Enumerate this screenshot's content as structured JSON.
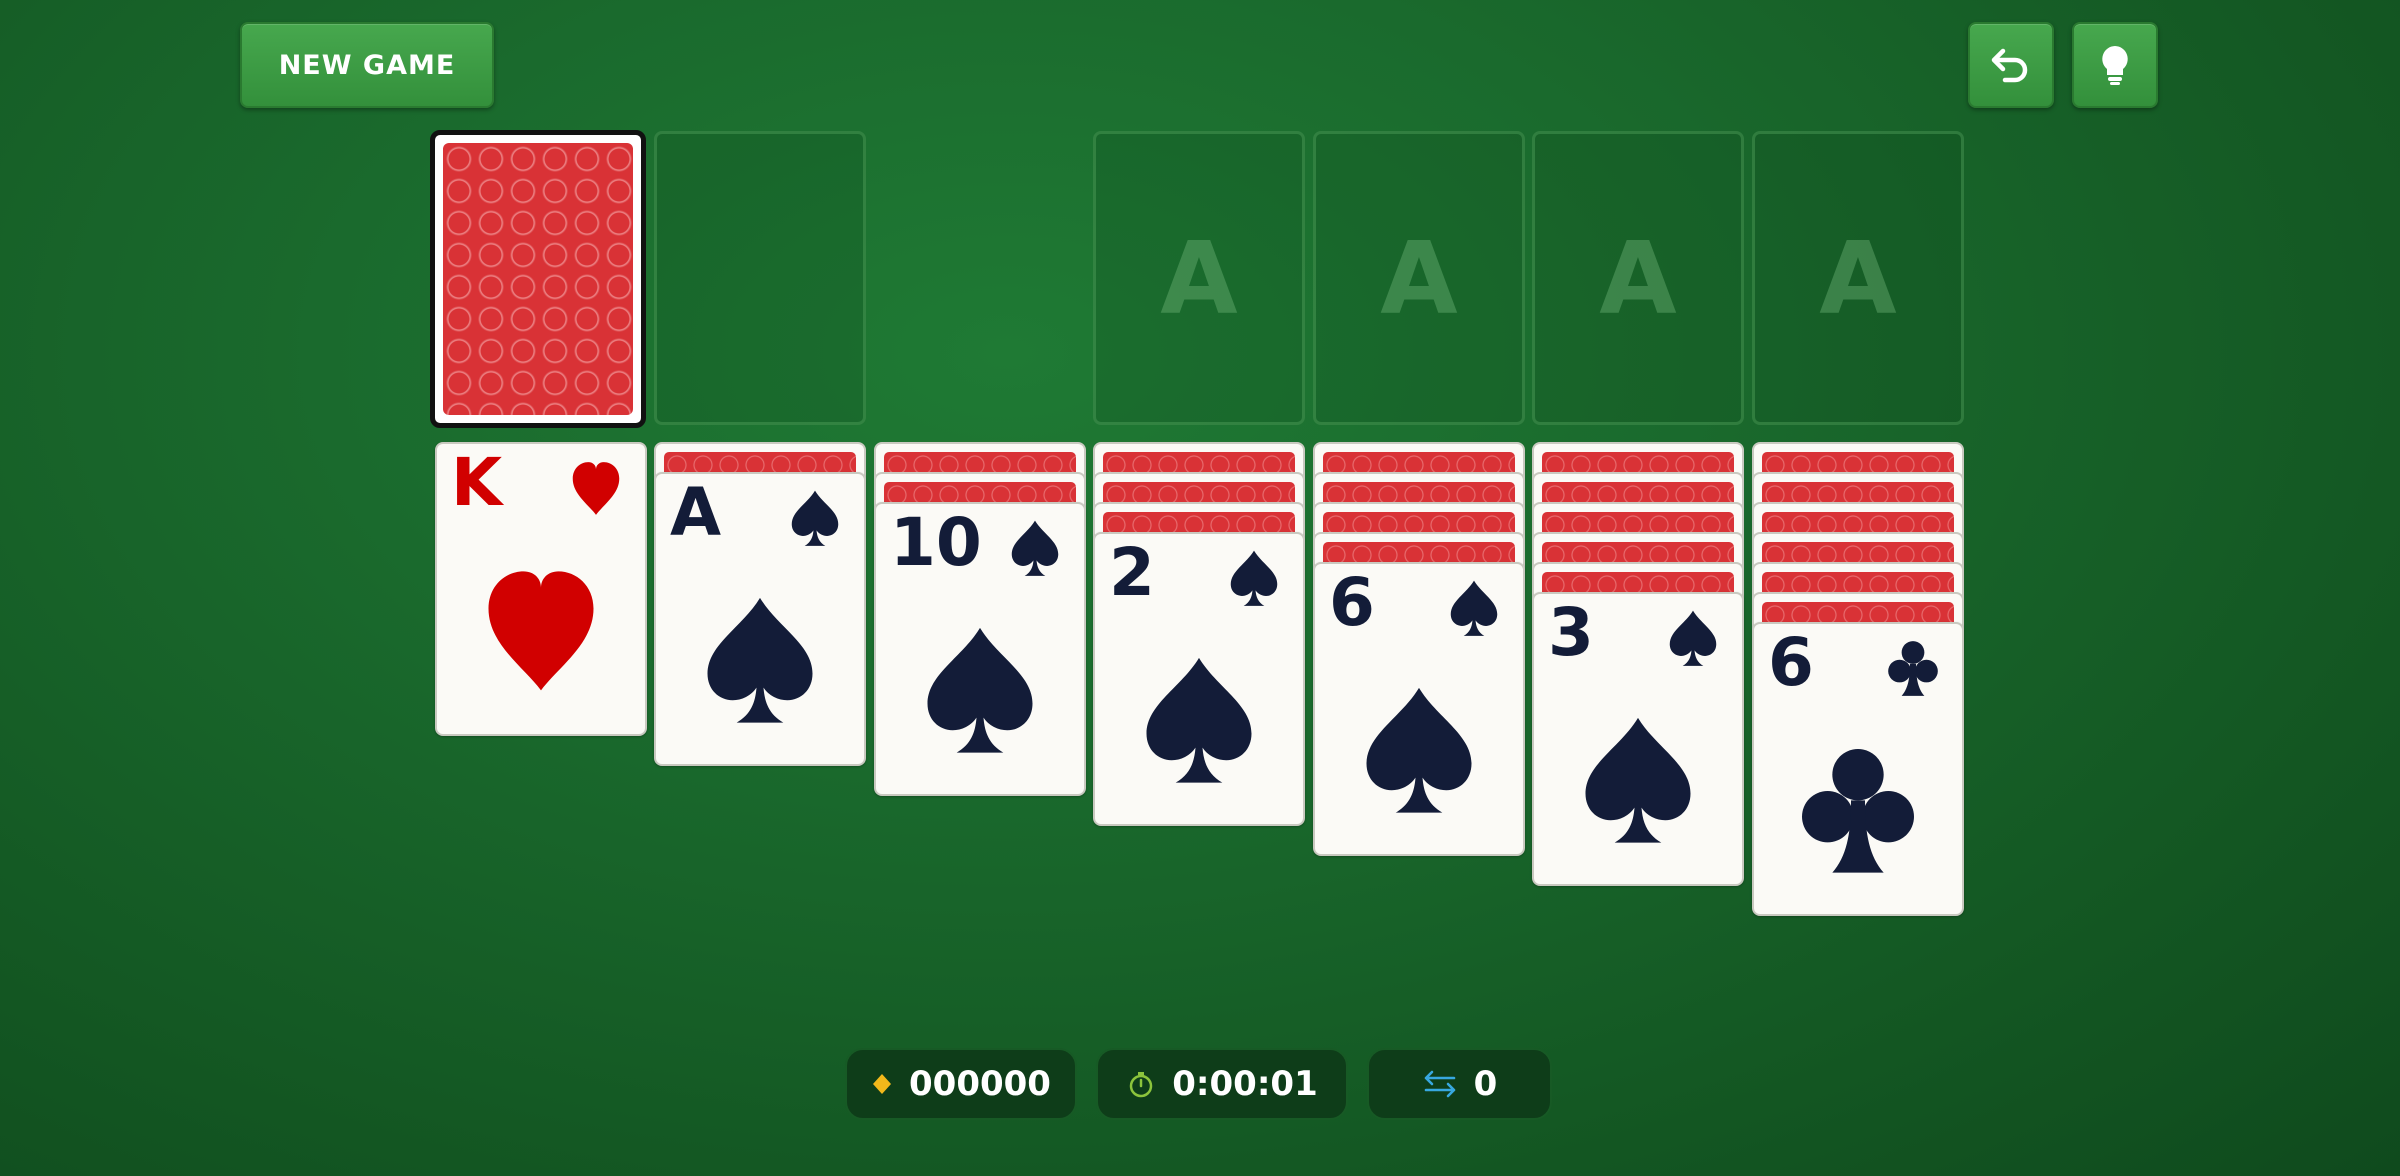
{
  "toolbar": {
    "new_game_label": "NEW GAME",
    "undo_icon": "undo-arrow-icon",
    "hint_icon": "lightbulb-icon"
  },
  "foundations": [
    {
      "label": "A"
    },
    {
      "label": "A"
    },
    {
      "label": "A"
    },
    {
      "label": "A"
    }
  ],
  "tableau": [
    {
      "face_down": 0,
      "top": {
        "rank": "K",
        "suit": "hearts"
      }
    },
    {
      "face_down": 1,
      "top": {
        "rank": "A",
        "suit": "spades"
      }
    },
    {
      "face_down": 2,
      "top": {
        "rank": "10",
        "suit": "spades"
      }
    },
    {
      "face_down": 3,
      "top": {
        "rank": "2",
        "suit": "spades"
      }
    },
    {
      "face_down": 4,
      "top": {
        "rank": "6",
        "suit": "spades"
      }
    },
    {
      "face_down": 5,
      "top": {
        "rank": "3",
        "suit": "spades"
      }
    },
    {
      "face_down": 6,
      "top": {
        "rank": "6",
        "suit": "clubs"
      }
    }
  ],
  "stats": {
    "score": "000000",
    "time": "0:00:01",
    "moves": "0"
  },
  "colors": {
    "red_suit": "#d10000",
    "black_suit": "#131c38",
    "score_diamond": "#f2b81b",
    "timer_icon": "#8cc43c",
    "moves_icon": "#38a8e0"
  }
}
